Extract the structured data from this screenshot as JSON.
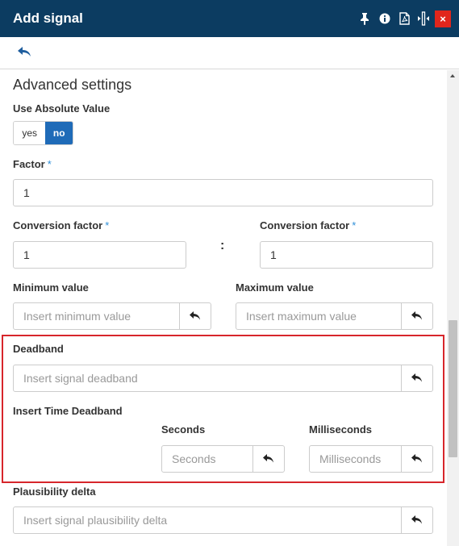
{
  "window": {
    "title": "Add signal",
    "toolbar_icons": [
      "pin-icon",
      "info-icon",
      "pdf-icon",
      "resize-width-icon",
      "close-icon"
    ],
    "close_glyph": "×"
  },
  "nav": {
    "back_icon": "back-arrow-icon"
  },
  "form": {
    "section_title": "Advanced settings",
    "use_absolute_value": {
      "label": "Use Absolute Value",
      "options": [
        "yes",
        "no"
      ],
      "selected": "no"
    },
    "factor": {
      "label": "Factor",
      "required_mark": "*",
      "value": "1"
    },
    "conversion_factor_left": {
      "label": "Conversion factor",
      "required_mark": "*",
      "value": "1"
    },
    "ratio_separator": ":",
    "conversion_factor_right": {
      "label": "Conversion factor",
      "required_mark": "*",
      "value": "1"
    },
    "minimum_value": {
      "label": "Minimum value",
      "placeholder": "Insert minimum value"
    },
    "maximum_value": {
      "label": "Maximum value",
      "placeholder": "Insert maximum value"
    },
    "deadband": {
      "label": "Deadband",
      "placeholder": "Insert signal deadband"
    },
    "time_deadband": {
      "label": "Insert Time Deadband",
      "seconds": {
        "label": "Seconds",
        "placeholder": "Seconds"
      },
      "milliseconds": {
        "label": "Milliseconds",
        "placeholder": "Milliseconds"
      }
    },
    "plausibility_delta": {
      "label": "Plausibility delta",
      "placeholder": "Insert signal plausibility delta"
    }
  },
  "colors": {
    "titlebar": "#0c3c61",
    "toggle_active": "#1f6bb8",
    "close_button": "#e1261c",
    "required_mark": "#2f8fd8",
    "highlight_border": "#d7262b"
  }
}
